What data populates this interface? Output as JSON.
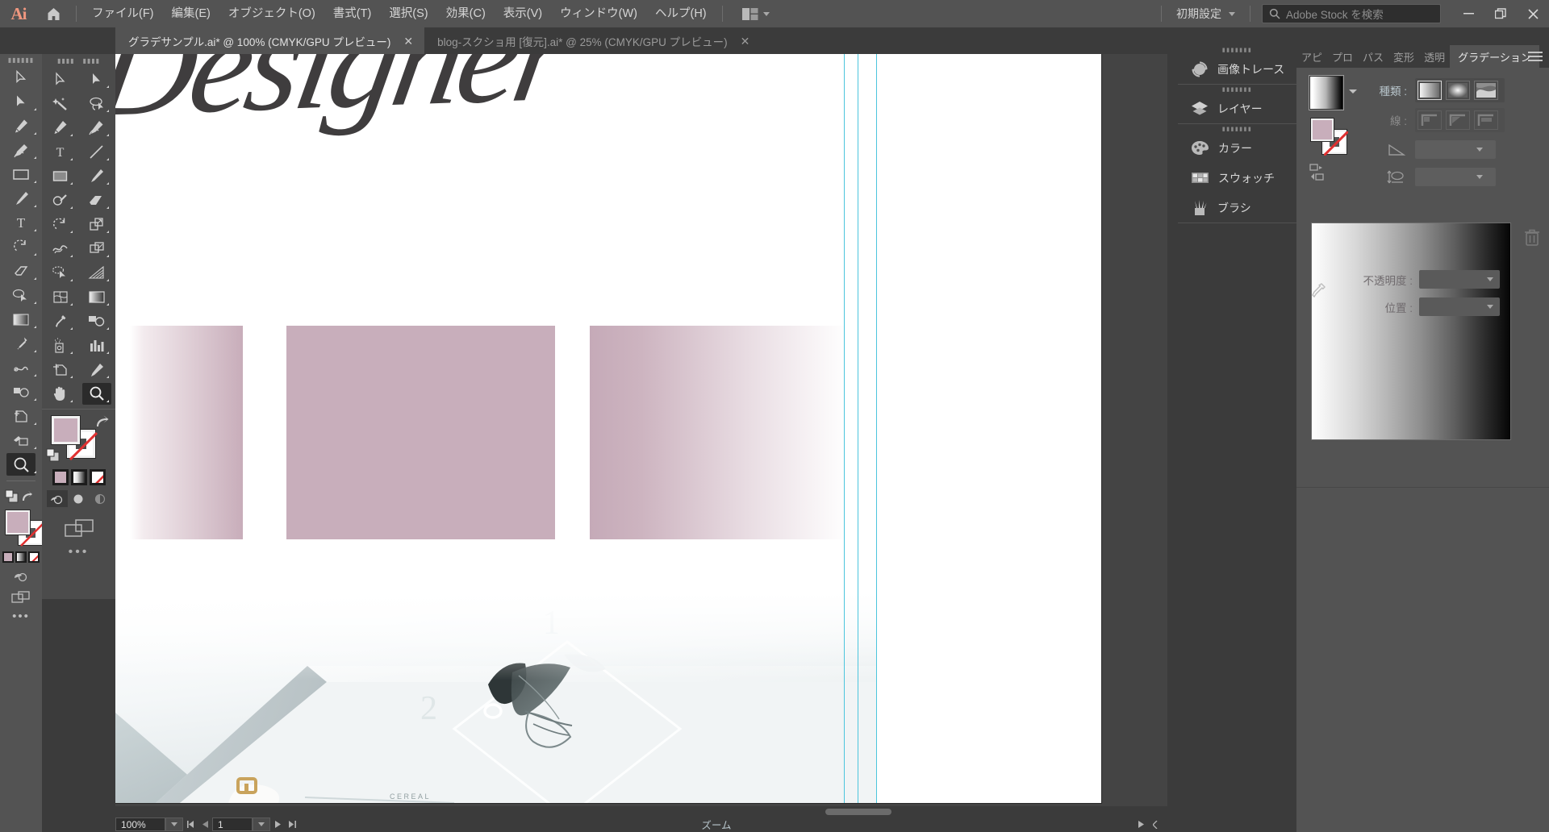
{
  "app": {
    "name": "Ai",
    "logo_color": "#f0977f"
  },
  "menubar": {
    "home_icon": "home-icon",
    "items": [
      "ファイル(F)",
      "編集(E)",
      "オブジェクト(O)",
      "書式(T)",
      "選択(S)",
      "効果(C)",
      "表示(V)",
      "ウィンドウ(W)",
      "ヘルプ(H)"
    ],
    "arrange_icon": "arrange-documents-icon",
    "workspace": "初期設定",
    "search": {
      "icon": "search-icon",
      "placeholder": "Adobe Stock を検索",
      "value": ""
    },
    "window_controls": {
      "minimize": "–",
      "restore": "❐",
      "close": "✕"
    }
  },
  "tabs": [
    {
      "title": "グラデサンプル.ai* @ 100% (CMYK/GPU プレビュー)",
      "active": true,
      "close": "✕"
    },
    {
      "title": "blog-スクショ用 [復元].ai* @ 25% (CMYK/GPU プレビュー)",
      "active": false,
      "close": "✕"
    }
  ],
  "toolbar": {
    "selected_tool": "zoom-tool",
    "tools": [
      "selection-tool",
      "direct-selection-tool",
      "magic-wand-tool",
      "lasso-tool",
      "pen-tool",
      "curvature-tool",
      "type-tool",
      "line-segment-tool",
      "rectangle-tool",
      "paintbrush-tool",
      "shaper-tool",
      "eraser-tool",
      "rotate-tool",
      "scale-tool",
      "width-tool",
      "free-transform-tool",
      "shape-builder-tool",
      "perspective-grid-tool",
      "mesh-tool",
      "gradient-tool",
      "eyedropper-tool",
      "blend-tool",
      "symbol-sprayer-tool",
      "column-graph-tool",
      "artboard-tool",
      "slice-tool",
      "hand-tool",
      "zoom-tool"
    ],
    "fill_color": "#c8aebb",
    "stroke_color": "none",
    "fill_label": "fill-swatch",
    "stroke_label": "stroke-swatch",
    "swap_icon": "swap-fill-stroke-icon",
    "default_icon": "default-fill-stroke-icon",
    "color_mode_buttons": [
      "color-button",
      "gradient-button",
      "none-button"
    ],
    "screen_mode_buttons": [
      "draw-normal-button",
      "draw-behind-button",
      "draw-inside-button"
    ],
    "change_screen_mode": "change-screen-mode-icon",
    "more_tools": "…"
  },
  "canvas": {
    "script_text": "Designer",
    "artboard_bg": "#ffffff",
    "swatch_rects": [
      {
        "name": "gradient-rect-white-to-pink",
        "from": "#ffffff",
        "to": "#c8adba"
      },
      {
        "name": "solid-rect-pink",
        "from": "#c8aebb",
        "to": "#c8aebb"
      },
      {
        "name": "gradient-rect-pink-to-white",
        "from": "#c5aab8",
        "to": "#ffffff"
      }
    ],
    "guide_color": "#4cc5dd",
    "guide_count": 3,
    "photo_caption": "CEREAL",
    "photo_numbers": [
      "1",
      "2"
    ]
  },
  "statusbar": {
    "zoom_value": "100%",
    "page_value": "1",
    "status_text": "ズーム",
    "nav_first": "first-page-icon",
    "nav_prev": "prev-page-icon",
    "nav_next": "next-page-icon",
    "nav_last": "last-page-icon"
  },
  "dock": {
    "groups": [
      {
        "items": [
          {
            "label": "画像トレース",
            "icon": "image-trace-icon"
          }
        ]
      },
      {
        "items": [
          {
            "label": "レイヤー",
            "icon": "layers-icon"
          }
        ]
      },
      {
        "items": [
          {
            "label": "カラー",
            "icon": "color-palette-icon"
          },
          {
            "label": "スウォッチ",
            "icon": "swatches-icon"
          },
          {
            "label": "ブラシ",
            "icon": "brushes-icon"
          }
        ]
      }
    ]
  },
  "gradient_panel": {
    "tabs": [
      {
        "label": "アピ",
        "active": false
      },
      {
        "label": "プロ",
        "active": false
      },
      {
        "label": "パス",
        "active": false
      },
      {
        "label": "変形",
        "active": false
      },
      {
        "label": "透明",
        "active": false
      },
      {
        "label": "グラデーション",
        "active": true
      }
    ],
    "menu_icon": "panel-menu-icon",
    "gradient_thumbnail": "gradient-preview-swatch",
    "gradient_preset_dropdown": "gradient-preset-dropdown-icon",
    "fill_color": "#c8aebb",
    "stroke_color": "none",
    "reverse_gradient_icon": "reverse-gradient-icon",
    "kind_label": "種類 :",
    "kind_buttons": [
      {
        "name": "linear-gradient-button",
        "selected": true
      },
      {
        "name": "radial-gradient-button",
        "selected": false
      },
      {
        "name": "freeform-gradient-button",
        "selected": false
      }
    ],
    "stroke_label": "線 :",
    "stroke_buttons": [
      "stroke-within-button",
      "stroke-along-button",
      "stroke-across-button"
    ],
    "angle_label_icon": "gradient-angle-icon",
    "angle_value": "",
    "aspect_label_icon": "gradient-aspect-ratio-icon",
    "aspect_value": "",
    "ramp_label": "gradient-slider-ramp",
    "delete_stop_icon": "delete-stop-trash-icon",
    "eyedropper_icon": "gradient-eyedropper-icon",
    "opacity_label": "不透明度 :",
    "opacity_value": "",
    "position_label": "位置 :",
    "position_value": ""
  }
}
